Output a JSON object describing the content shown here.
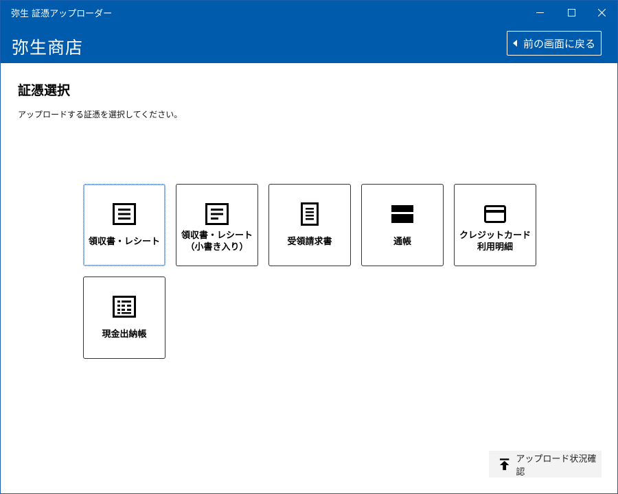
{
  "window": {
    "title": "弥生 証憑アップローダー",
    "minimize_glyph": "—",
    "maximize_glyph": "☐",
    "close_glyph": "✕"
  },
  "header": {
    "shop_name": "弥生商店",
    "back_label": "前の画面に戻る"
  },
  "main": {
    "title": "証憑選択",
    "description": "アップロードする証憑を選択してください。",
    "tiles": [
      {
        "label_line1": "領収書・レシート",
        "label_line2": "",
        "icon": "receipt-icon",
        "selected": true
      },
      {
        "label_line1": "領収書・レシート",
        "label_line2": "（小書き入り）",
        "icon": "receipt-note-icon",
        "selected": false
      },
      {
        "label_line1": "受領請求書",
        "label_line2": "",
        "icon": "invoice-icon",
        "selected": false
      },
      {
        "label_line1": "通帳",
        "label_line2": "",
        "icon": "passbook-icon",
        "selected": false
      },
      {
        "label_line1": "クレジットカード",
        "label_line2": "利用明細",
        "icon": "credit-card-icon",
        "selected": false
      },
      {
        "label_line1": "現金出納帳",
        "label_line2": "",
        "icon": "cash-book-icon",
        "selected": false
      }
    ]
  },
  "footer": {
    "status_label": "アップロード状況確認"
  },
  "colors": {
    "brand": "#005bac"
  }
}
